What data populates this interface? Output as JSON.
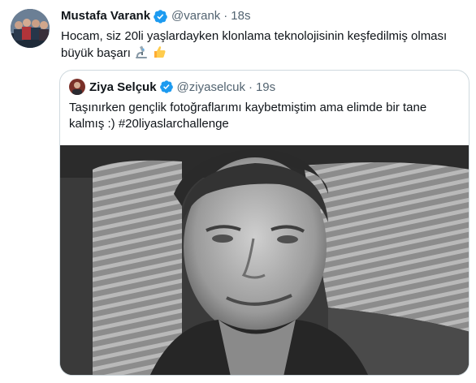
{
  "tweet": {
    "author_name": "Mustafa Varank",
    "author_handle": "@varank",
    "separator": "·",
    "time": "18s",
    "text": "Hocam, siz 20li yaşlardayken klonlama teknolojisinin keşfedilmiş olması büyük başarı",
    "emojis": [
      "microscope-emoji",
      "thumbs-up-emoji"
    ]
  },
  "quoted": {
    "author_name": "Ziya Selçuk",
    "author_handle": "@ziyaselcuk",
    "separator": "·",
    "time": "19s",
    "text": "Taşınırken gençlik fotoğraflarımı kaybetmiştim ama elimde bir tane kalmış :) #20liyaslarchallenge",
    "media": "black-and-white-portrait-photo"
  },
  "colors": {
    "text": "#0f1419",
    "secondary": "#536471",
    "verified": "#1d9bf0",
    "border": "#cfd9de"
  }
}
